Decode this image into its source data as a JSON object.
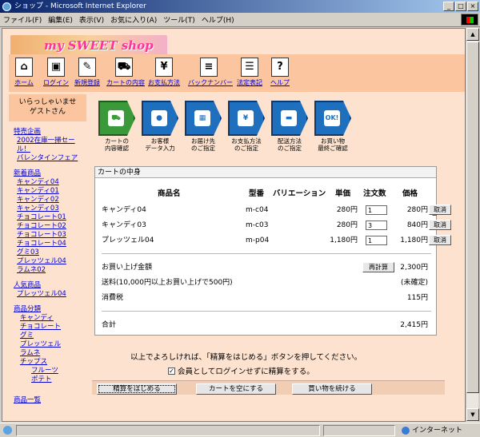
{
  "window": {
    "title": "ショップ - Microsoft Internet Explorer",
    "btn_min": "_",
    "btn_max": "□",
    "btn_close": "×"
  },
  "menu": [
    "ファイル(F)",
    "編集(E)",
    "表示(V)",
    "お気に入り(A)",
    "ツール(T)",
    "ヘルプ(H)"
  ],
  "logo": {
    "text": "my SWEET shop"
  },
  "nav": [
    {
      "label": "ホーム",
      "icon": "home-icon",
      "glyph": "⌂"
    },
    {
      "label": "ログイン",
      "icon": "monitor-icon",
      "glyph": "▣"
    },
    {
      "label": "新規登録",
      "icon": "pen-icon",
      "glyph": "✎"
    },
    {
      "label": "カートの内容",
      "icon": "cart-icon",
      "glyph": "⛟"
    },
    {
      "label": "お支払方法",
      "icon": "yen-icon",
      "glyph": "¥"
    },
    {
      "label": "バックナンバー",
      "icon": "magazine-icon",
      "glyph": "≡"
    },
    {
      "label": "法定表記",
      "icon": "document-icon",
      "glyph": "☰"
    },
    {
      "label": "ヘルプ",
      "icon": "help-icon",
      "glyph": "?"
    }
  ],
  "welcome": {
    "line1": "いらっしゃいませ",
    "line2": "ゲストさん"
  },
  "sidebar": {
    "special": {
      "head": "特売企画",
      "items": [
        "2002在庫一掃セール！",
        "バレンタインフェア"
      ]
    },
    "new": {
      "head": "新着商品",
      "items": [
        "キャンディ04",
        "キャンディ01",
        "キャンディ02",
        "キャンディ03",
        "チョコレート01",
        "チョコレート02",
        "チョコレート03",
        "チョコレート04",
        "グミ03",
        "プレッツェル04",
        "ラムネ02"
      ]
    },
    "popular": {
      "head": "人気商品",
      "items": [
        "プレッツェル04"
      ]
    },
    "category": {
      "head": "商品分類",
      "items": [
        "キャンディ",
        "チョコレート",
        "グミ",
        "プレッツェル",
        "ラムネ",
        "チップス"
      ],
      "sub": [
        "フルーツ",
        "ポテト"
      ]
    },
    "all": {
      "head": "商品一覧"
    }
  },
  "steps": [
    {
      "label1": "カートの",
      "label2": "内容確認",
      "icon": "cart-step-icon",
      "glyph": "⛟",
      "active": true
    },
    {
      "label1": "お客様",
      "label2": "データ入力",
      "icon": "person-icon",
      "glyph": "●",
      "active": false
    },
    {
      "label1": "お届け先",
      "label2": "のご指定",
      "icon": "box-icon",
      "glyph": "▦",
      "active": false
    },
    {
      "label1": "お支払方法",
      "label2": "のご指定",
      "icon": "card-icon",
      "glyph": "¥",
      "active": false
    },
    {
      "label1": "配送方法",
      "label2": "のご指定",
      "icon": "truck-icon",
      "glyph": "▬",
      "active": false
    },
    {
      "label1": "お買い物",
      "label2": "最終ご確認",
      "icon": "ok-icon",
      "glyph": "OK!",
      "active": false
    }
  ],
  "cart": {
    "title": "カートの中身",
    "headers": {
      "name": "商品名",
      "model": "型番",
      "variation": "バリエーション",
      "price": "単価",
      "qty": "注文数",
      "amount": "価格"
    },
    "rows": [
      {
        "name": "キャンディ04",
        "model": "m-c04",
        "variation": "",
        "price": "280円",
        "qty": "1",
        "amount": "280円",
        "remove": "取消"
      },
      {
        "name": "キャンディ03",
        "model": "m-c03",
        "variation": "",
        "price": "280円",
        "qty": "3",
        "amount": "840円",
        "remove": "取消"
      },
      {
        "name": "プレッツェル04",
        "model": "m-p04",
        "variation": "",
        "price": "1,180円",
        "qty": "1",
        "amount": "1,180円",
        "remove": "取消"
      }
    ],
    "subtotal_label": "お買い上げ金額",
    "recalc": "再計算",
    "subtotal": "2,300円",
    "shipping_label": "送料(10,000円以上お買い上げで500円)",
    "shipping": "(未確定)",
    "tax_label": "消費税",
    "tax": "115円",
    "total_label": "合計",
    "total": "2,415円"
  },
  "footer": {
    "message": "以上でよろしければ、「精算をはじめる」ボタンを押してください。",
    "checkbox_label": "会員としてログインせずに精算をする。",
    "checked": "✓",
    "btn_checkout": "精算をはじめる",
    "btn_empty": "カートを空にする",
    "btn_continue": "買い物を続ける"
  },
  "status": {
    "zone": "インターネット"
  }
}
